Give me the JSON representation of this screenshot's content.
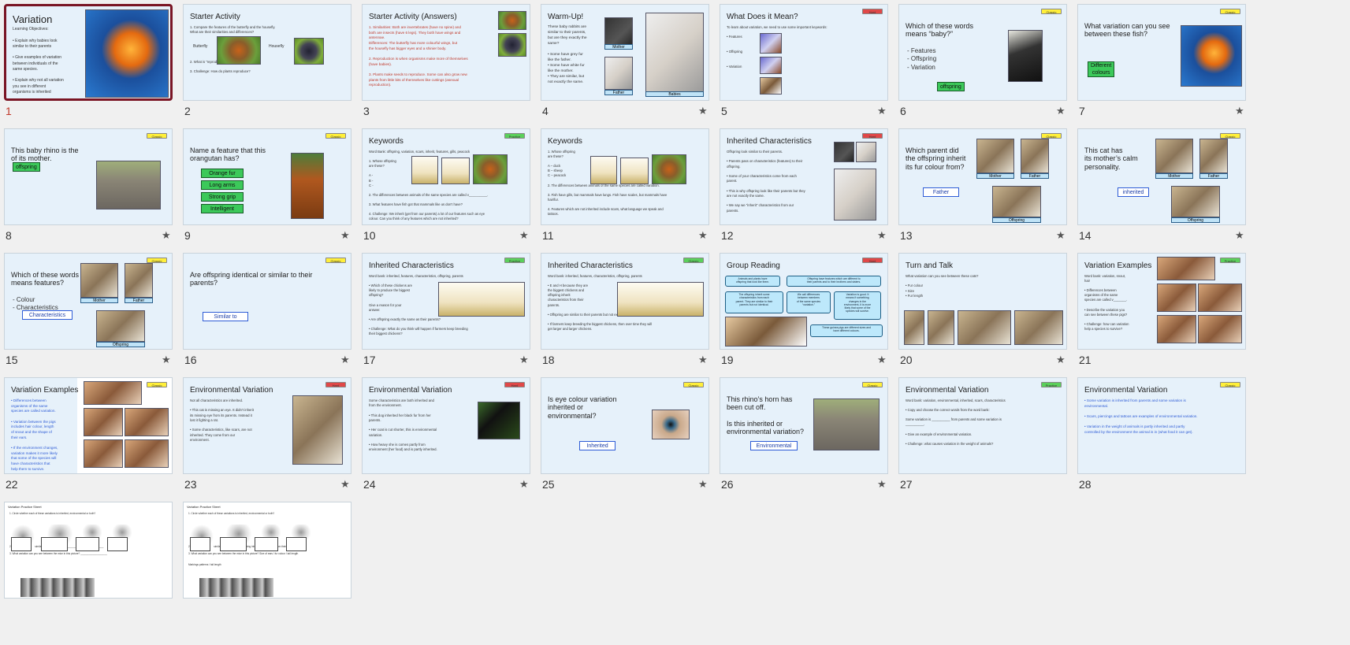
{
  "app": "slide-sorter",
  "slides": [
    {
      "num": "1",
      "title": "Variation",
      "text": "Learning Objectives:\n\n•  Explain why babies look\n   similar to their parents\n\n•  Give examples of variation\n   between individuals of the\n   same species.\n\n•  Explain why not all variation\n   you see in different\n   organisms is inherited",
      "star": "",
      "tag": ""
    },
    {
      "num": "2",
      "title": "Starter Activity",
      "text": "1.   Compare the features of the butterfly and the housefly.\n      What are their similarities and differences?\n\n\n\n\n\n2.   What is “reproduction?”\n\n3.   Challenge: How do plants reproduce?",
      "star": "",
      "tag": "",
      "sub1": "Butterfly",
      "sub2": "Housefly"
    },
    {
      "num": "3",
      "title": "Starter Activity (Answers)",
      "text": "1.  Similarities: Both are invertebrates (have no spine) and\n     both are insects (have 6 legs). They both have wings and\n     antennae.\n     Differences: The butterfly has more colourful wings, but\n     the housefly has bigger eyes and a shinier body.\n\n2.  Reproduction is when organisms make more of themselves\n     (have babies).\n\n3.  Plants make seeds to reproduce. Some can also grow new\n     plants from little bits of themselves like cuttings (asexual\n     reproduction).",
      "star": "",
      "tag": ""
    },
    {
      "num": "4",
      "title": "Warm-Up!",
      "text": "These baby rabbits are\nsimilar to their parents,\nbut are they exactly the\nsame?\n\n•  Some have grey fur\n   like the father.\n•  Some have white fur\n   like the mother.\n•  They are similar, but\n   not exactly the same.",
      "star": "★",
      "tag": "",
      "l1": "Mother",
      "l2": "Father",
      "l3": "Babies"
    },
    {
      "num": "5",
      "title": "What Does it Mean?",
      "text": "To learn about variation, we need to use some important keywords:\n\n•  Features\n\n\n•  Offspring\n\n\n•  Variation",
      "star": "★",
      "tag": "Hard"
    },
    {
      "num": "6",
      "title": "Which of these words\nmeans “baby?”",
      "text": "- Features\n- Offspring\n- Variation",
      "star": "★",
      "tag": "Classic",
      "answer": "offspring"
    },
    {
      "num": "7",
      "title": "What variation can you see\nbetween these fish?",
      "text": "",
      "star": "★",
      "tag": "Classic",
      "answer": "Different\ncolours"
    },
    {
      "num": "8",
      "title": "This baby rhino is the\n              of its mother.",
      "text": "",
      "star": "★",
      "tag": "Classic",
      "answer": "offspring"
    },
    {
      "num": "9",
      "title": "Name a feature that this\norangutan has?",
      "text": "",
      "star": "★",
      "tag": "Classic",
      "answers": [
        "Orange fur",
        "Long arms",
        "Strong grip",
        "Intelligent"
      ]
    },
    {
      "num": "10",
      "title": "Keywords",
      "text": "Word Bank: offspring, variation, scars, inherit, features, gills, peacock\n\n1.   Whose offspring\n      are these?\n\n      A -\n      B -\n      C -\n\n2.  The differences between animals of the same species are called v__________.\n\n3.  What features have fish got that mammals like us don’t have?\n\n4.  Challenge: We inherit (get from our parents) a lot of our features such as eye\n     colour. Can you think of any features which are not inherited?",
      "star": "★",
      "tag": "Practice"
    },
    {
      "num": "11",
      "title": "Keywords",
      "text": "1.   Whose offspring\n      are these?\n\n      A – duck\n      B – sheep\n      C – peacock\n\n2.  The differences between animals of the same species are called variation.\n\n3.  Fish have gills, but mammals have lungs. Fish have scales, but mammals have\n     hair/fur.\n\n4.  Features which are not inherited include scars, what language we speak and\n     tattoos.",
      "star": "★",
      "tag": ""
    },
    {
      "num": "12",
      "title": "Inherited Characteristics",
      "text": "Offspring look similar to their parents.\n\n•  Parents pass on characteristics (features) to their\n   offspring.\n\n•  Some of your characteristics come from each\n   parent.\n\n•  This is why offspring look like their parents but they\n   are not exactly the same.\n\n•  We say we “inherit” characteristics from our\n   parents.",
      "star": "★",
      "tag": "Hard"
    },
    {
      "num": "13",
      "title": "Which parent did\nthe offspring inherit\nits fur colour from?",
      "text": "",
      "star": "★",
      "tag": "Classic",
      "answer": "Father",
      "l1": "Mother",
      "l2": "Father",
      "l3": "Offspring"
    },
    {
      "num": "14",
      "title": "This cat has\nits mother’s calm\npersonality.",
      "text": "",
      "star": "★",
      "tag": "Classic",
      "answer": "inherited",
      "l1": "Mother",
      "l2": "Father",
      "l3": "Offspring"
    },
    {
      "num": "15",
      "title": "Which of these words\nmeans features?",
      "text": "- Colour\n- Characteristics",
      "star": "★",
      "tag": "Classic",
      "answer": "Characteristics",
      "l1": "Mother",
      "l2": "Father",
      "l3": "Offspring"
    },
    {
      "num": "16",
      "title": "Are offspring identical or similar to their\nparents?",
      "text": "",
      "star": "★",
      "tag": "Classic",
      "answer": "Similar to"
    },
    {
      "num": "17",
      "title": "Inherited Characteristics",
      "text": "Word bank: inherited, features, characteristics, offspring, parents\n\n•  Which of these chickens are\n   likely to produce the biggest\n   offspring?\n\n   Give a reason for your\n   answer.\n\n•  Are offspring exactly the same as their parents?\n\n•  Challenge: What do you think will happen if farmers keep breeding\n   their biggest chickens?",
      "star": "★",
      "tag": "Practice"
    },
    {
      "num": "18",
      "title": "Inherited Characteristics",
      "text": "Word bank: inherited, features, characteristics, offspring, parents\n\n•  E and H because they are\n   the biggest chickens and\n   offspring inherit\n   characteristics from their\n   parents.\n\n•  Offspring are similar to their parents but not exactly the same.\n\n•  If farmers keep breeding the biggest chickens, then over time they will\n   get larger and larger chickens.",
      "star": "★",
      "tag": "Classic"
    },
    {
      "num": "19",
      "title": "Group Reading",
      "text": "",
      "star": "★",
      "tag": "Hard",
      "bubbles": [
        "Animals and plants have\noffspring that look like them.",
        "Offspring have features which are different to\ntheir parents and to their brothers and sisters.",
        "The offspring inherit some\ncharacteristics from each\nparent. They are similar to their\nparents but not identical.",
        "We call differences\nbetween members\nof the same species\n“variation.”",
        "Variation is good. It\nmeans if something\nchanges in the\nenvironment, it is more\nlikely that some of the\nspecies will survive.",
        "These guinea pigs are different sizes and\nhave different colours."
      ]
    },
    {
      "num": "20",
      "title": "Turn and Talk",
      "text": "What variation can you see between these cats?\n\n•  Fur colour\n•  Size\n•  Fur length",
      "star": "★",
      "tag": ""
    },
    {
      "num": "21",
      "title": "Variation Examples",
      "text": "Word bank: variation, snout,\nhair\n\n•  Differences between\n   organisms of the same\n   species are called v_______.\n\n•  Describe the variation you\n   can see between these pigs?\n\n•  Challenge: how can variation\n   help a species to survive?",
      "star": "",
      "tag": "Practice"
    },
    {
      "num": "22",
      "title": "Variation Examples",
      "text": "•  Differences between\n   organisms of the same\n   species are called variation.\n\n•  Variation between the pigs\n   includes hair colour, length\n   of snout and the shape of\n   their ears.\n\n•  If the environment changes,\n   variation makes it more likely\n   that some of the species will\n   have characteristics that\n   help them to survive.",
      "star": "",
      "tag": "Classic"
    },
    {
      "num": "23",
      "title": "Environmental Variation",
      "text": "Not all characteristics are inherited.\n\n•  This cat is missing an eye. It didn’t inherit\n   its missing eye from its parents. Instead it\n   lost it fighting a rat.\n\n•  Some characteristics, like scars, are not\n   inherited. They come from our\n   environment.",
      "star": "★",
      "tag": "Hard"
    },
    {
      "num": "24",
      "title": "Environmental Variation",
      "text": "Some characteristics are both inherited and\nfrom the environment.\n\n•  This dog inherited her black fur from her\n   parents.\n\n•  Her coat is cut shorter, this is environmental\n   variation.\n\n•  How heavy she is comes partly from\n   environment (her food) and is partly inherited.",
      "star": "★",
      "tag": "Hard"
    },
    {
      "num": "25",
      "title": "Is eye colour variation\ninherited or\nenvironmental?",
      "text": "",
      "star": "★",
      "tag": "Classic",
      "answer": "Inherited"
    },
    {
      "num": "26",
      "title": "This rhino’s horn has\nbeen cut off.\n\nIs this inherited or\nenvironmental variation?",
      "text": "",
      "star": "★",
      "tag": "Classic",
      "answer": "Environmental"
    },
    {
      "num": "27",
      "title": "Environmental Variation",
      "text": "Word bank: variation, environmental, inherited, scars, characteristics\n\n•  Copy and choose the correct words from the word bank:\n\n   Some variation is __________ from parents and some variation is\n   __________.\n\n•  Give an example of environmental variation.\n\n•  Challenge: what causes variation in the weight of animals?",
      "star": "",
      "tag": "Practice"
    },
    {
      "num": "28",
      "title": "Environmental Variation",
      "text": "•  Some variation is inherited from parents and some variation is\n   environmental.\n\n•  Scars, piercings and tattoos are examples of environmental variation.\n\n•  Variation in the weight of animals is partly inherited and partly\n   controlled by the environment the animal is in (what food it can get).",
      "star": "",
      "tag": "Classic"
    },
    {
      "num": "",
      "title": "Variation Practice Sheet",
      "text": "1.   Circle whether each of these variations is inherited, environmental or both?\n\n\n\n\n\n\n\n\n2.   Why do babies look similar to their parents? ______________________________\n\n3.   What variation can you see between the mice in this picture? ___________________",
      "star": "",
      "tag": ""
    },
    {
      "num": "",
      "title": "Variation Practice Sheet",
      "text": "1.   Circle whether each of these variations is inherited, environmental or both?\n\n\n\n\n\n\n\n\n2.   Why do babies look similar to their parents? Offspring inherit characteristics from their parents.\n\n3.   What variation can you see between the mice in this picture? Size of ears / fur colour / tail length\n\n\n                                                                                          Markings patterns / tail length",
      "star": "",
      "tag": ""
    }
  ],
  "colors": {
    "selected_border": "#7a1524",
    "slide_bg": "#e6f1fa",
    "answer_green": "#3cc95a",
    "tag_yellow": "#ffef3a",
    "tag_green": "#5bd05b",
    "tag_red": "#e04848"
  }
}
